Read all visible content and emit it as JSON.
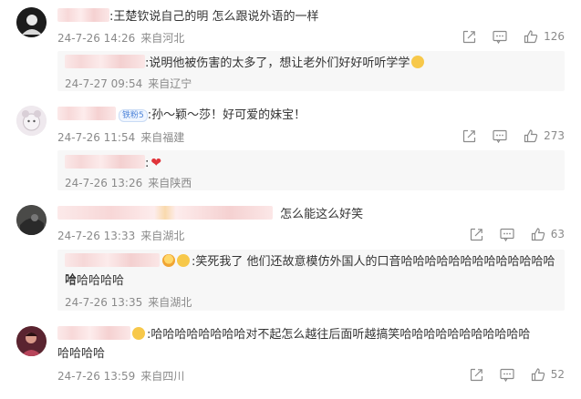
{
  "comments": [
    {
      "text": ":王楚钦说自己的明 怎么跟说外语的一样",
      "date": "24-7-26 14:26",
      "location": "来自河北",
      "likes": "126",
      "reply": {
        "text": ":说明他被伤害的太多了，想让老外们好好听听学学",
        "date": "24-7-27 09:54",
        "location": "来自辽宁"
      }
    },
    {
      "badge": "铁粉5",
      "text": ":孙～颖～莎！好可爱的妹宝！",
      "date": "24-7-26 11:54",
      "location": "来自福建",
      "likes": "273",
      "reply": {
        "text": ":",
        "date": "24-7-26 13:26",
        "location": "来自陕西"
      }
    },
    {
      "text": "怎么能这么好笑",
      "date": "24-7-26 13:33",
      "location": "来自湖北",
      "likes": "63",
      "reply": {
        "text_line1": ":笑死我了 他们还故意模仿外国人的口音哈哈哈哈哈哈哈哈哈哈哈哈哈哈",
        "text_line2": "哈哈哈哈哈",
        "date": "24-7-26 13:35",
        "location": "来自湖北"
      }
    },
    {
      "text_line1": ":哈哈哈哈哈哈哈哈对不起怎么越往后面听越搞笑哈哈哈哈哈哈哈哈哈哈哈",
      "text_line2": "哈哈哈哈",
      "date": "24-7-26 13:59",
      "location": "来自四川",
      "likes": "52"
    }
  ],
  "icons": {
    "share": "share-icon",
    "comment": "comment-icon",
    "like": "thumbs-up-icon"
  }
}
